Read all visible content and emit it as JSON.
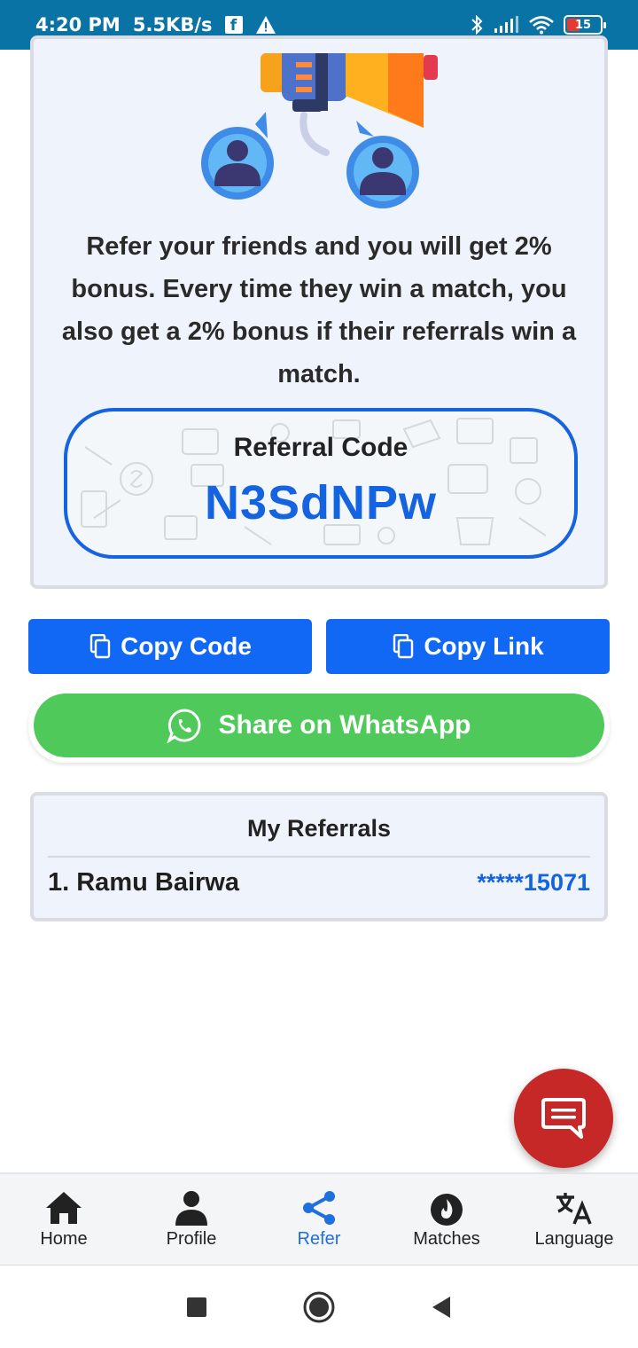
{
  "status_bar": {
    "time": "4:20 PM",
    "speed": "5.5KB/s",
    "fb": "f",
    "battery": "15"
  },
  "refer_card": {
    "message": "Refer your friends and you will get 2% bonus. Every time they win a match, you also get a 2% bonus if their referrals win a match.",
    "code_label": "Referral Code",
    "code_value": "N3SdNPw"
  },
  "actions": {
    "copy_code": "Copy Code",
    "copy_link": "Copy Link",
    "share_whatsapp": "Share on WhatsApp"
  },
  "referrals": {
    "title": "My Referrals",
    "items": [
      {
        "name": "1. Ramu Bairwa",
        "phone": "*****15071"
      }
    ]
  },
  "bottom_nav": [
    {
      "label": "Home",
      "icon": "home-icon"
    },
    {
      "label": "Profile",
      "icon": "person-icon"
    },
    {
      "label": "Refer",
      "icon": "share-icon"
    },
    {
      "label": "Matches",
      "icon": "fire-icon"
    },
    {
      "label": "Language",
      "icon": "translate-icon"
    }
  ],
  "colors": {
    "primary": "#1168f5",
    "whatsapp": "#4fc95a",
    "fab": "#c62828",
    "status_bar": "#0a73a6"
  }
}
